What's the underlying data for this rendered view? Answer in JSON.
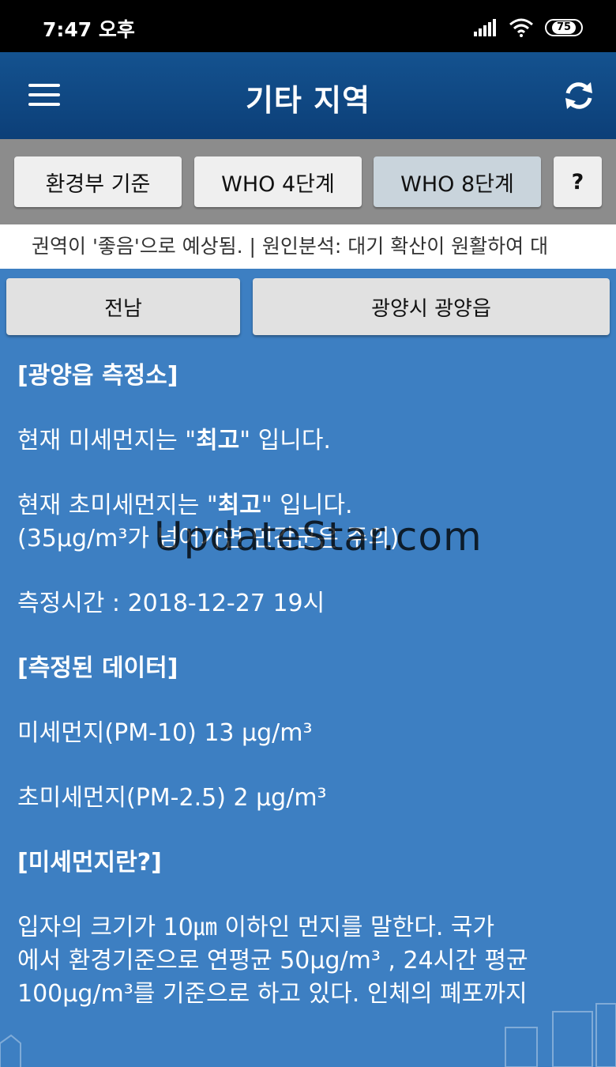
{
  "status_bar": {
    "time": "7:47 오후",
    "battery": "75"
  },
  "app_bar": {
    "title": "기타 지역",
    "menu_icon": "hamburger-menu-icon",
    "refresh_icon": "refresh-icon"
  },
  "tabs": [
    {
      "label": "환경부 기준",
      "active": false
    },
    {
      "label": "WHO 4단계",
      "active": false
    },
    {
      "label": "WHO 8단계",
      "active": true
    },
    {
      "label": "?",
      "active": false
    }
  ],
  "ticker": {
    "text": "권역이 '좋음'으로 예상됨. | 원인분석:  대기 확산이 원활하여 대"
  },
  "region": {
    "province": "전남",
    "station": "광양시 광양읍"
  },
  "content": {
    "station_title": "[광양읍 측정소]",
    "pm10_prefix": "현재 미세먼지는 \"",
    "pm10_grade": "최고",
    "pm10_suffix": "\" 입니다.",
    "pm25_prefix": "현재 초미세먼지는 \"",
    "pm25_grade": "최고",
    "pm25_suffix": "\" 입니다.",
    "pm25_note": "(35μg/m³가 넘어가면 민감군은 주의)",
    "measure_time": "측정시간 : 2018-12-27 19시",
    "data_heading": "[측정된 데이터]",
    "pm10_value": "미세먼지(PM-10) 13 μg/m³",
    "pm25_value": "초미세먼지(PM-2.5) 2 μg/m³",
    "about_heading": "[미세먼지란?]",
    "about_line1": "입자의 크기가 10㎛ 이하인 먼지를 말한다. 국가",
    "about_line2": "에서 환경기준으로 연평균 50μg/m³ , 24시간 평균",
    "about_line3": "100μg/m³를 기준으로 하고 있다. 인체의 폐포까지"
  },
  "watermark": "UpdateStar.com",
  "colors": {
    "background": "#3d7fc2",
    "app_bar": "#0f4883",
    "tab_active": "#c9d4dc"
  }
}
